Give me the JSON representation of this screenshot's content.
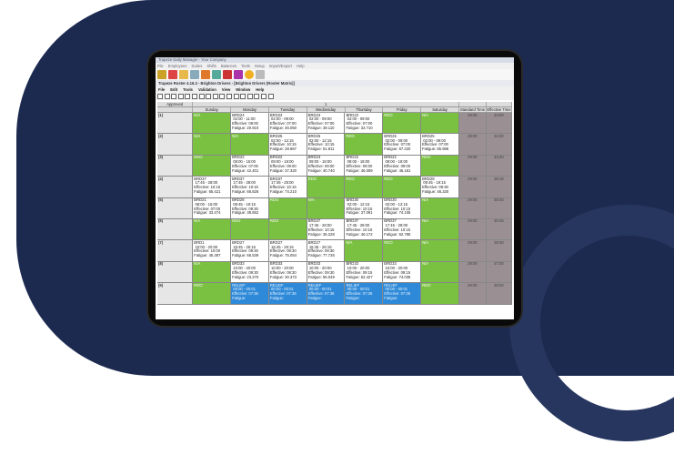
{
  "app": {
    "title": "Trapeze Daily Manager - Your Company"
  },
  "main_menu": [
    "File",
    "Employees",
    "Duties",
    "Shifts",
    "Balances",
    "Tools",
    "Setup",
    "Import/Export",
    "Help"
  ],
  "sub_window": {
    "title": "Trapeze Roster 4.16.3 - Brighton Drivers - [Brighton Drivers (Roster Matrix)]"
  },
  "sub_menu": [
    "File",
    "Edit",
    "Tools",
    "Validation",
    "View",
    "Window",
    "Help"
  ],
  "grid": {
    "approved_label": "Approved",
    "week_label": "1",
    "days": [
      "Sunday",
      "Monday",
      "Tuesday",
      "Wednesday",
      "Thursday",
      "Friday",
      "Saturday"
    ],
    "extra_cols": [
      "Standard Time",
      "Effective Time"
    ],
    "rows": [
      {
        "label": "(1)",
        "cells": [
          {
            "c": "g",
            "t": "N/A"
          },
          {
            "c": "w",
            "t": "BRD24\n 02:00 - 11:00\nEffective: 09:00\nFatigue: 20.910"
          },
          {
            "c": "w",
            "t": "BRD23\n 02:00 - 09:00\nEffective: 07:00\nFatigue: 46.050"
          },
          {
            "c": "w",
            "t": "BRD23\n 02:00 - 09:00\nEffective: 07:00\nFatigue: 39.110"
          },
          {
            "c": "w",
            "t": "BRD23\n 02:00 - 09:00\nEffective: 07:00\nFatigue: 32.710"
          },
          {
            "c": "g",
            "t": "RDO"
          },
          {
            "c": "g",
            "t": "N/A"
          }
        ],
        "std": "29:00",
        "eff": "34:00"
      },
      {
        "label": "(2)",
        "cells": [
          {
            "c": "g",
            "t": "N/A"
          },
          {
            "c": "g",
            "t": "N/A"
          },
          {
            "c": "w",
            "t": "BRD25\n 02:00 - 12:15\nEffective: 10:15\nFatigue: 28.867"
          },
          {
            "c": "w",
            "t": "BRD25\n 02:00 - 12:15\nEffective: 10:15\nFatigue: 51.811"
          },
          {
            "c": "g",
            "t": "RDO"
          },
          {
            "c": "w",
            "t": "BRD25\n 02:00 - 09:00\nEffective: 07:00\nFatigue: 67.220"
          },
          {
            "c": "w",
            "t": "BRD25\n 02:00 - 09:00\nEffective: 07:00\nFatigue: 85.986"
          }
        ],
        "std": "29:00",
        "eff": "34:30"
      },
      {
        "label": "(3)",
        "cells": [
          {
            "c": "g",
            "t": "RDO"
          },
          {
            "c": "w",
            "t": "BRD22\n 08:00 - 15:00\nEffective: 07:00\nFatigue: 42.401"
          },
          {
            "c": "w",
            "t": "BRD22\n 09:00 - 18:00\nEffective: 09:00\nFatigue: 37.320"
          },
          {
            "c": "w",
            "t": "BRD23\n 09:00 - 18:00\nEffective: 09:00\nFatigue: 40.740"
          },
          {
            "c": "w",
            "t": "BRD22\n 09:00 - 18:00\nEffective: 09:00\nFatigue: 46.009"
          },
          {
            "c": "w",
            "t": "BRD22\n 09:00 - 18:00\nEffective: 09:00\nFatigue: 46.181"
          },
          {
            "c": "g",
            "t": "RDO"
          }
        ],
        "std": "29:00",
        "eff": "43:30"
      },
      {
        "label": "(4)",
        "cells": [
          {
            "c": "w",
            "t": "BRD37\n 17:45 - 28:00\nEffective: 10:15\nFatigue: 65.421"
          },
          {
            "c": "w",
            "t": "BRD37\n 17:45 - 28:00\nEffective: 10:15\nFatigue: 66.826"
          },
          {
            "c": "w",
            "t": "BRD37\n 17:45 - 28:00\nEffective: 10:15\nFatigue: 74.210"
          },
          {
            "c": "g",
            "t": "RDO"
          },
          {
            "c": "g",
            "t": "RDO"
          },
          {
            "c": "g",
            "t": "RDO"
          },
          {
            "c": "w",
            "t": "BRD28\n 09:45 - 19:15\nEffective: 09:30\nFatigue: 46.330"
          }
        ],
        "std": "29:00",
        "eff": "39:15"
      },
      {
        "label": "(5)",
        "cells": [
          {
            "c": "w",
            "t": "BRD21\n 08:00 - 15:00\nEffective: 07:00\nFatigue: 33.474"
          },
          {
            "c": "w",
            "t": "BRD28\n 09:45 - 19:15\nEffective: 09:30\nFatigue: 38.652"
          },
          {
            "c": "g",
            "t": "RDO"
          },
          {
            "c": "g",
            "t": "N/A"
          },
          {
            "c": "w",
            "t": "BRD30\n 02:00 - 12:15\nEffective: 10:15\nFatigue: 37.091"
          },
          {
            "c": "w",
            "t": "BRD30\n 02:00 - 12:15\nEffective: 10:15\nFatigue: 74.105"
          },
          {
            "c": "g",
            "t": "N/A"
          }
        ],
        "std": "29:00",
        "eff": "36:30"
      },
      {
        "label": "(6)",
        "cells": [
          {
            "c": "g",
            "t": "N/A"
          },
          {
            "c": "g",
            "t": "RDO"
          },
          {
            "c": "g",
            "t": "RDO"
          },
          {
            "c": "w",
            "t": "BRD37\n 17:45 - 28:00\nEffective: 10:15\nFatigue: 35.228"
          },
          {
            "c": "w",
            "t": "BRD37\n 17:45 - 28:00\nEffective: 10:15\nFatigue: 46.172"
          },
          {
            "c": "w",
            "t": "BRD37\n 17:45 - 28:00\nEffective: 10:15\nFatigue: 62.785"
          },
          {
            "c": "g",
            "t": "N/A"
          }
        ],
        "std": "29:00",
        "eff": "30:45"
      },
      {
        "label": "(7)",
        "cells": [
          {
            "c": "w",
            "t": "BRD1\n 10:00 - 20:00\nEffective: 10:00\nFatigue: 45.387"
          },
          {
            "c": "w",
            "t": "BRD27\n 16:45 - 26:15\nEffective: 09:30\nFatigue: 66.539"
          },
          {
            "c": "w",
            "t": "BRD27\n 16:45 - 26:15\nEffective: 09:30\nFatigue: 75.054"
          },
          {
            "c": "w",
            "t": "BRD27\n 16:45 - 26:15\nEffective: 09:30\nFatigue: 77.726"
          },
          {
            "c": "g",
            "t": "N/A"
          },
          {
            "c": "g",
            "t": "RDO"
          },
          {
            "c": "g",
            "t": "N/A"
          }
        ],
        "std": "29:00",
        "eff": "38:30"
      },
      {
        "label": "(8)",
        "cells": [
          {
            "c": "g",
            "t": "N/A"
          },
          {
            "c": "w",
            "t": "BRD33\n 10:00 - 20:00\nEffective: 09:30\nFatigue: 23.270"
          },
          {
            "c": "w",
            "t": "BRD33\n 10:00 - 20:00\nEffective: 09:30\nFatigue: 30.373"
          },
          {
            "c": "w",
            "t": "BRD33\n 10:00 - 20:00\nEffective: 09:30\nFatigue: 55.049"
          },
          {
            "c": "w",
            "t": "BRD33\n 10:00 - 20:00\nEffective: 09:15\nFatigue: 62.427"
          },
          {
            "c": "w",
            "t": "BRD33\n 10:00 - 20:00\nEffective: 09:15\nFatigue: 74.035"
          },
          {
            "c": "g",
            "t": "N/A"
          }
        ],
        "std": "29:00",
        "eff": "47:00"
      },
      {
        "label": "(9)",
        "cells": [
          {
            "c": "g",
            "t": "RDO"
          },
          {
            "c": "b",
            "t": "RELIEF\n 00:00 - 00:01\nEffective: 07:36\nFatigue:"
          },
          {
            "c": "b",
            "t": "RELIEF\n 00:00 - 00:01\nEffective: 07:36\nFatigue:"
          },
          {
            "c": "b",
            "t": "RELIEF\n 00:00 - 00:01\nEffective: 07:36\nFatigue:"
          },
          {
            "c": "b",
            "t": "RELIEF\n 00:00 - 00:01\nEffective: 07:36\nFatigue:"
          },
          {
            "c": "b",
            "t": "RELIEF\n 00:00 - 00:01\nEffective: 07:36\nFatigue:"
          },
          {
            "c": "g",
            "t": "RDO"
          }
        ],
        "std": "29:00",
        "eff": "38:00"
      }
    ]
  }
}
